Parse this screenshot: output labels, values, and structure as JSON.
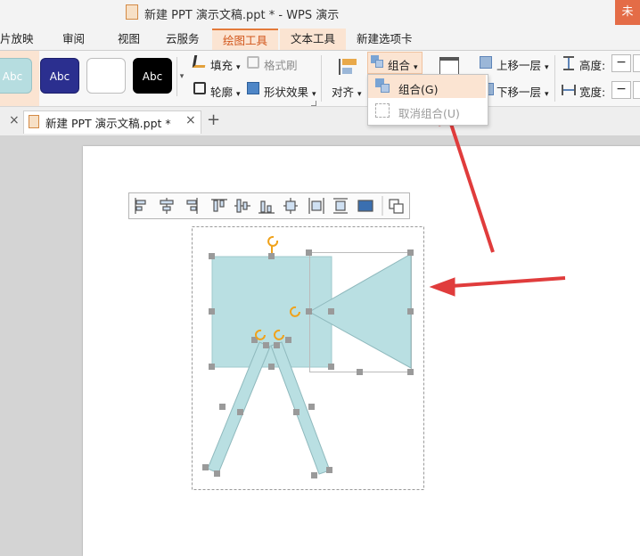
{
  "window": {
    "title": "新建 PPT 演示文稿.ppt * - WPS 演示",
    "corner_button": "未"
  },
  "ribbon_tabs": [
    "片放映",
    "审阅",
    "视图",
    "云服务",
    "绘图工具",
    "文本工具",
    "新建选项卡"
  ],
  "shape_styles": [
    {
      "label": "Abc",
      "bg": "#b6dde0",
      "fg": "#ffffff"
    },
    {
      "label": "Abc",
      "bg": "#2b2f8f",
      "fg": "#ffffff"
    },
    {
      "label": "",
      "bg": "#ffffff",
      "fg": "#000000"
    },
    {
      "label": "Abc",
      "bg": "#000000",
      "fg": "#ffffff"
    }
  ],
  "ribbon": {
    "fill": "填充",
    "format_painter": "格式刷",
    "outline": "轮廓",
    "shape_effects": "形状效果",
    "align": "对齐",
    "group": "组合",
    "bring_forward": "上移一层",
    "send_backward": "下移一层",
    "height_label": "高度:",
    "width_label": "宽度:",
    "stepper_minus": "−"
  },
  "group_menu": {
    "group_item": "组合(G)",
    "ungroup_item": "取消组合(U)"
  },
  "document_tab": {
    "label": "新建 PPT 演示文稿.ppt *",
    "close": "×",
    "add": "+"
  },
  "colors": {
    "accent_orange": "#e37a3a",
    "tab_highlight": "#fbe4d2",
    "shape_fill": "#b9dfe2",
    "shape_stroke": "#8fb9bd",
    "handle": "#9a9a9a",
    "rotate_handle": "#f0a21a",
    "arrow_red": "#e03c3c"
  }
}
